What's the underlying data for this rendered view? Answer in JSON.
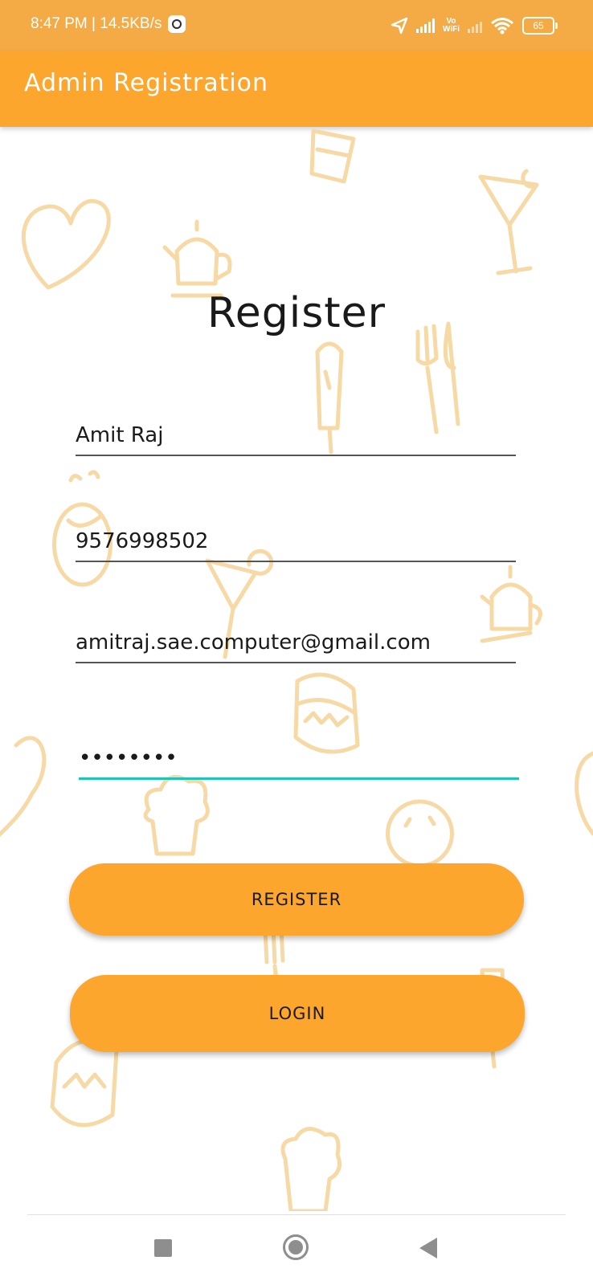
{
  "status_bar": {
    "time_speed": "8:47 PM | 14.5KB/s",
    "vowifi_top": "Vo",
    "vowifi_bottom": "WiFi",
    "battery": "65",
    "icons": [
      "app-notification-icon",
      "location-arrow-icon",
      "signal-icon",
      "vowifi-icon",
      "signal-no-service-icon",
      "wifi-icon",
      "battery-icon"
    ]
  },
  "app_bar": {
    "title": "Admin Registration"
  },
  "form": {
    "heading": "Register",
    "name_value": "Amit Raj",
    "phone_value": "9576998502",
    "email_value": "amitraj.sae.computer@gmail.com",
    "password_value": "••••••••"
  },
  "buttons": {
    "register": "REGISTER",
    "login": "LOGIN"
  },
  "nav_bar": {
    "icons": [
      "recents-square-icon",
      "home-circle-icon",
      "back-triangle-icon"
    ]
  },
  "colors": {
    "status_bar": "#f4aa45",
    "app_bar": "#fca62e",
    "button": "#fca62e",
    "focus_underline": "#1fc4b4",
    "doodle": "#f7d9a6"
  }
}
